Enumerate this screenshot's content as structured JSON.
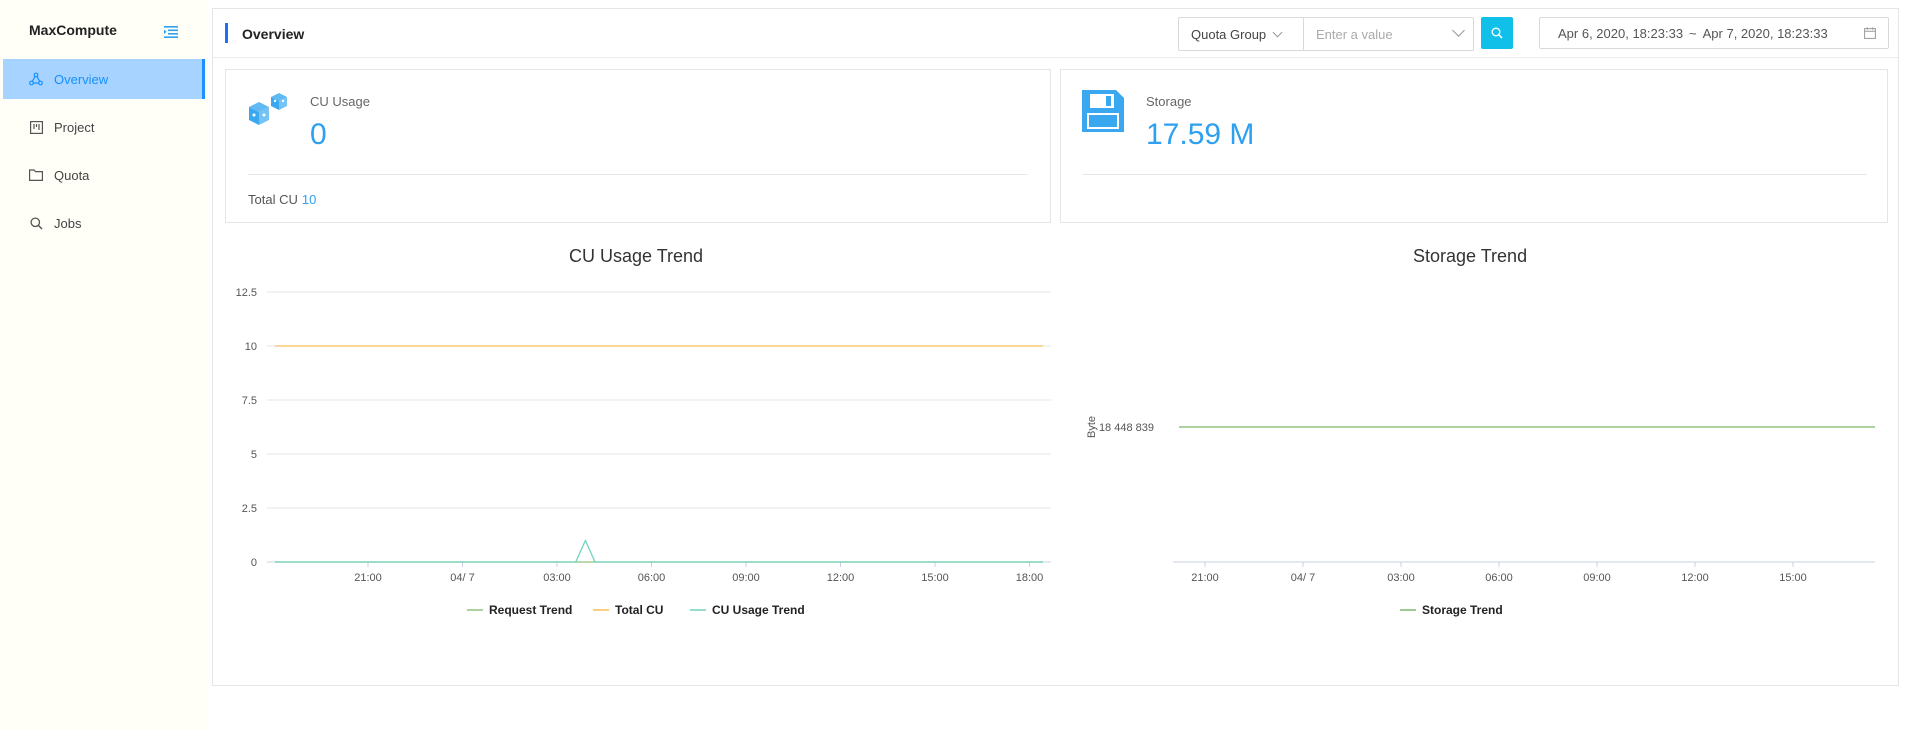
{
  "sidebar": {
    "brand": "MaxCompute",
    "items": [
      {
        "label": "Overview",
        "icon": "cluster-icon",
        "active": true
      },
      {
        "label": "Project",
        "icon": "project-icon",
        "active": false
      },
      {
        "label": "Quota",
        "icon": "folder-icon",
        "active": false
      },
      {
        "label": "Jobs",
        "icon": "search-icon",
        "active": false
      }
    ]
  },
  "header": {
    "title": "Overview",
    "quota_select": "Quota Group",
    "value_placeholder": "Enter a value",
    "date_start": "Apr 6, 2020, 18:23:33",
    "date_sep": "~",
    "date_end": "Apr 7, 2020, 18:23:33"
  },
  "cards": {
    "cu": {
      "label": "CU Usage",
      "value": "0",
      "footer_label": "Total CU",
      "footer_value": "10"
    },
    "storage": {
      "label": "Storage",
      "value": "17.59 M"
    }
  },
  "colors": {
    "accent": "#2ea0f0",
    "request": "#91c47a",
    "total": "#f5c15a",
    "usage": "#6fd3c0",
    "storage": "#7cb86a"
  },
  "chart_data": [
    {
      "type": "line",
      "title": "CU Usage Trend",
      "x_ticks": [
        "21:00",
        "04/ 7",
        "03:00",
        "06:00",
        "09:00",
        "12:00",
        "15:00",
        "18:00"
      ],
      "y_ticks": [
        "12.5",
        "10",
        "7.5",
        "5",
        "2.5",
        "0"
      ],
      "ylim": [
        0,
        12.5
      ],
      "xlim_hours": [
        0,
        24
      ],
      "series": [
        {
          "name": "Request Trend",
          "points": [
            [
              0,
              0
            ],
            [
              24,
              0
            ]
          ]
        },
        {
          "name": "Total CU",
          "points": [
            [
              0,
              10
            ],
            [
              24,
              10
            ]
          ]
        },
        {
          "name": "CU Usage Trend",
          "points": [
            [
              0,
              0
            ],
            [
              9.4,
              0
            ],
            [
              9.7,
              1
            ],
            [
              10.0,
              0
            ],
            [
              24,
              0
            ]
          ]
        }
      ],
      "legend": "bottom"
    },
    {
      "type": "line",
      "title": "Storage Trend",
      "ylabel": "Byte",
      "x_ticks": [
        "21:00",
        "04/ 7",
        "03:00",
        "06:00",
        "09:00",
        "12:00",
        "15:00"
      ],
      "y_ticks": [
        "18 448 839"
      ],
      "series": [
        {
          "name": "Storage Trend",
          "points": [
            [
              0,
              18448839
            ],
            [
              24,
              18448839
            ]
          ]
        }
      ],
      "legend": "bottom"
    }
  ]
}
